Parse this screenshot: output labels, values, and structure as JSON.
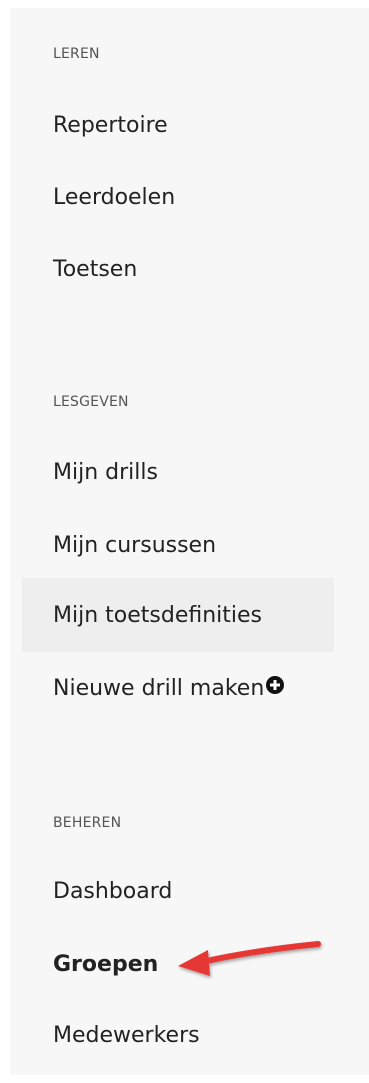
{
  "sections": [
    {
      "title": "LEREN",
      "items": [
        "Repertoire",
        "Leerdoelen",
        "Toetsen"
      ]
    },
    {
      "title": "LESGEVEN",
      "items": [
        "Mijn drills",
        "Mijn cursussen",
        "Mijn toetsdefinities",
        "Nieuwe drill maken"
      ]
    },
    {
      "title": "BEHEREN",
      "items": [
        "Dashboard",
        "Groepen",
        "Medewerkers"
      ]
    }
  ],
  "state": {
    "hovered_item": "Mijn toetsdefinities",
    "active_item": "Groepen"
  },
  "icons": {
    "new_drill": "plus-circle-icon",
    "annotation": "red-arrow-icon"
  },
  "colors": {
    "sidebar_bg": "#f7f7f7",
    "hover_bg": "#eeeeee",
    "arrow": "#e53935"
  }
}
